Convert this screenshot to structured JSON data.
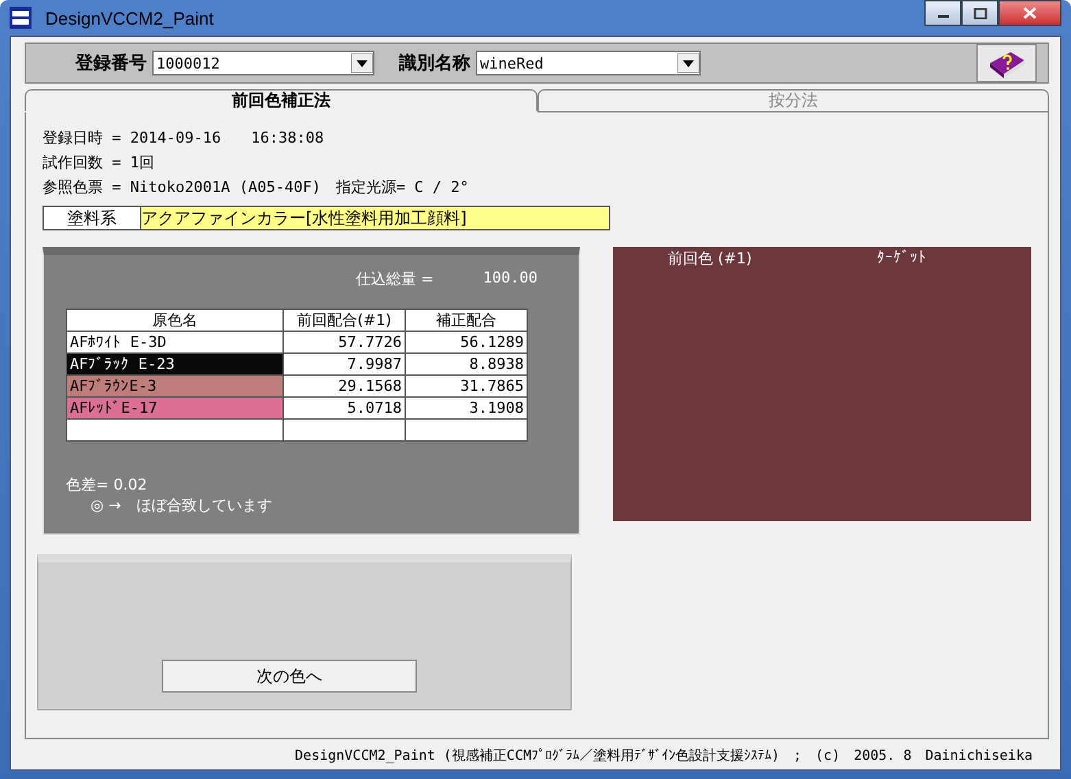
{
  "window": {
    "title": "DesignVCCM2_Paint"
  },
  "toolbar": {
    "registration_number": {
      "label": "登録番号",
      "value": "1000012"
    },
    "identification_name": {
      "label": "識別名称",
      "value": "wineRed"
    }
  },
  "tabs": [
    {
      "label": "前回色補正法",
      "selected": true
    },
    {
      "label": "按分法",
      "selected": false
    }
  ],
  "info": [
    "登録日時 = 2014-09-16　　16:38:08",
    "試作回数 = 1回",
    "参照色票 = Nitoko2001A (A05-40F)　指定光源= C / 2°"
  ],
  "paint_system": {
    "label": "塗料系",
    "value": "アクアファインカラー[水性塗料用加工顔料]"
  },
  "total": {
    "label": "仕込総量 =",
    "value": "100.00"
  },
  "table": {
    "columns": [
      "原色名",
      "前回配合(#1)",
      "補正配合"
    ],
    "rows": [
      {
        "name": "AFﾎﾜｲﾄ E-3D",
        "color": "#ffffff",
        "previous": "57.7726",
        "corrected": "56.1289"
      },
      {
        "name": "AFﾌﾞﾗｯｸ E-23",
        "color": "#0a0a0a",
        "previous": "7.9987",
        "corrected": "8.8938"
      },
      {
        "name": "AFﾌﾞﾗｳﾝE-3",
        "color": "#c07c78",
        "previous": "29.1568",
        "corrected": "31.7865"
      },
      {
        "name": "AFﾚｯﾄﾞE-17",
        "color": "#db7094",
        "previous": "5.0718",
        "corrected": "3.1908"
      }
    ]
  },
  "color_difference": {
    "label": "色差= 0.02",
    "verdict": "◎ →　ほぼ合致しています"
  },
  "swatches": [
    {
      "label": "前回色 (#1)",
      "color": "#6b363c"
    },
    {
      "label": "ﾀｰｹﾞｯﾄ",
      "color": "#6b363c"
    }
  ],
  "next_button": "次の色へ",
  "status_bar": "DesignVCCM2_Paint (視感補正CCMﾌﾟﾛｸﾞﾗﾑ／塗料用ﾃﾞｻﾞｲﾝ色設計支援ｼｽﾃﾑ)　;　(c)　2005. 8　Dainichiseika"
}
